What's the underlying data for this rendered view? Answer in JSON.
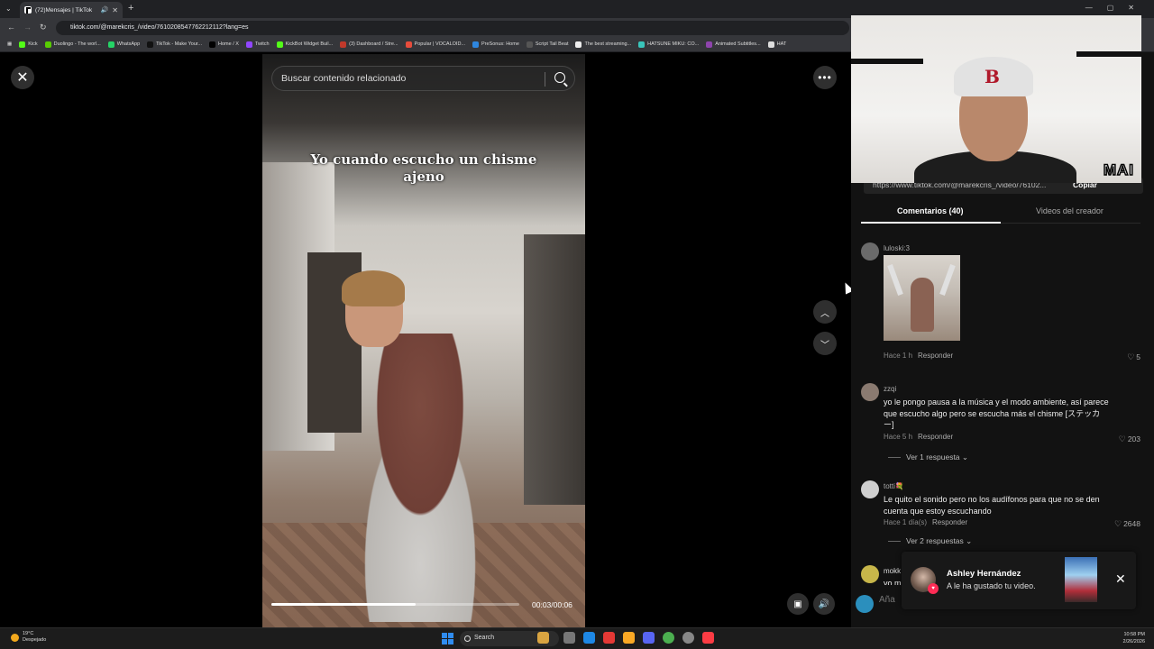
{
  "browser": {
    "tab_title": "(72)Mensajes | TikTok",
    "url": "tiktok.com/@marekcris_/video/7610208547762212112?lang=es",
    "bookmarks": [
      {
        "label": "Kick",
        "color": "#53fc18"
      },
      {
        "label": "Duolingo - The worl...",
        "color": "#58cc02"
      },
      {
        "label": "WhatsApp",
        "color": "#25d366"
      },
      {
        "label": "TikTok - Make Your...",
        "color": "#111111"
      },
      {
        "label": "Home / X",
        "color": "#000000"
      },
      {
        "label": "Twitch",
        "color": "#9146ff"
      },
      {
        "label": "KickBot Widget Buil...",
        "color": "#53fc18"
      },
      {
        "label": "(3) Dashboard / Stre...",
        "color": "#c0392b"
      },
      {
        "label": "Popular | VOCALOID...",
        "color": "#e74c3c"
      },
      {
        "label": "PreSonus: Home",
        "color": "#2e86de"
      },
      {
        "label": "Script Tail Beat",
        "color": "#555555"
      },
      {
        "label": "The best streaming...",
        "color": "#eeeeee"
      },
      {
        "label": "HATSUNE MIKU: CO...",
        "color": "#39c5bb"
      },
      {
        "label": "Animated Subtitles...",
        "color": "#8e44ad"
      },
      {
        "label": "HAT",
        "color": "#dddddd"
      }
    ]
  },
  "video": {
    "search_placeholder": "Buscar contenido relacionado",
    "caption": "Yo cuando escucho un chisme ajeno",
    "time": "00:03/00:06",
    "progress": 0.58
  },
  "webcam": {
    "cap_logo": "B",
    "watermark": "MAI"
  },
  "panel": {
    "share_url": "https://www.tiktok.com/@marekcris_/video/76102...",
    "copy_label": "Copiar",
    "tab_comments": "Comentarios (40)",
    "tab_creator": "Videos del creador",
    "comments": [
      {
        "user": "luloski:3",
        "text": "",
        "time": "Hace 1 h",
        "reply": "Responder",
        "likes": "5",
        "has_image": true
      },
      {
        "user": "zzqi",
        "text": "yo le pongo pausa a la música y el modo ambiente, así parece que escucho algo pero se escucha más el chisme [ステッカー]",
        "time": "Hace 5 h",
        "reply": "Responder",
        "likes": "203",
        "replies": "Ver 1 respuesta"
      },
      {
        "user": "totti💐",
        "text": "Le quito el sonido pero no los audífonos para que no se den cuenta que estoy escuchando",
        "time": "Hace 1 día(s)",
        "reply": "Responder",
        "likes": "2648",
        "replies": "Ver 2 respuestas"
      },
      {
        "user": "mokk",
        "text": "yo m"
      }
    ],
    "input_placeholder": "Aña"
  },
  "toast": {
    "name": "Ashley Hernández",
    "message": "A le ha gustado tu video."
  },
  "taskbar": {
    "temp": "19°C",
    "weather": "Despejado",
    "search": "Search",
    "time": "10:58 PM",
    "date": "2/26/2026"
  }
}
